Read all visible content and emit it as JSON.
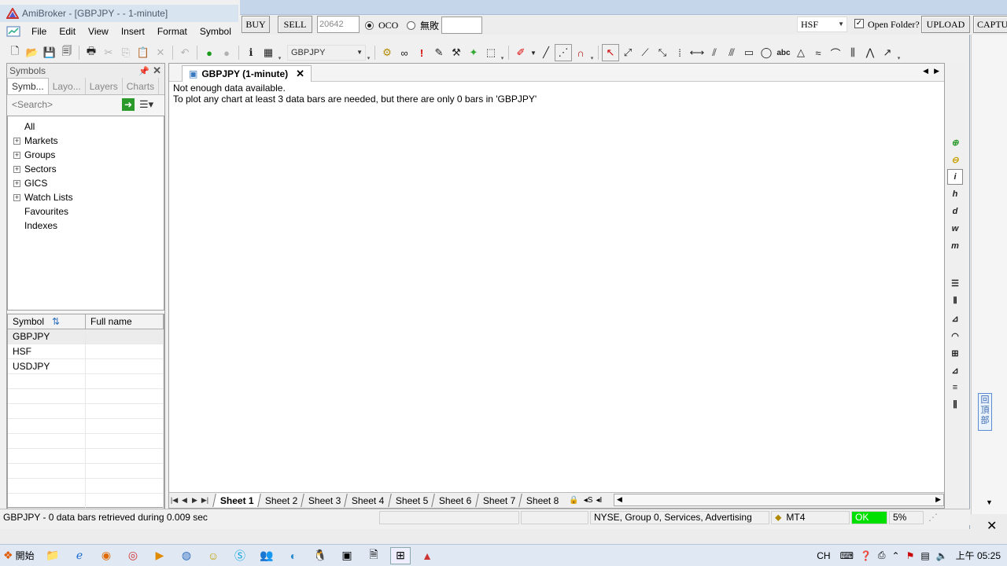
{
  "window": {
    "title": "AmiBroker - [GBPJPY -  - 1-minute]",
    "menu": [
      "File",
      "Edit",
      "View",
      "Insert",
      "Format",
      "Symbol"
    ]
  },
  "trade_bar": {
    "buy_label": "BUY",
    "sell_label": "SELL",
    "qty_value": "20642",
    "oco_label": "OCO",
    "oco_selected": true,
    "other_radio_label": "無敗",
    "symbol_value": "HSF",
    "open_folder_label": "Open Folder?",
    "open_folder_checked": true,
    "upload_label": "UPLOAD",
    "capture_label": "CAPTU"
  },
  "toolbar": {
    "symbol_combo": "GBPJPY"
  },
  "symbols_panel": {
    "title": "Symbols",
    "tabs": [
      "Symb...",
      "Layo...",
      "Layers",
      "Charts"
    ],
    "search_placeholder": "<Search>",
    "tree": [
      {
        "label": "All",
        "expandable": false
      },
      {
        "label": "Markets",
        "expandable": true
      },
      {
        "label": "Groups",
        "expandable": true
      },
      {
        "label": "Sectors",
        "expandable": true
      },
      {
        "label": "GICS",
        "expandable": true
      },
      {
        "label": "Watch Lists",
        "expandable": true
      },
      {
        "label": "Favourites",
        "expandable": false
      },
      {
        "label": "Indexes",
        "expandable": false
      }
    ],
    "columns": [
      "Symbol",
      "Full name"
    ],
    "rows": [
      {
        "symbol": "GBPJPY",
        "full_name": ""
      },
      {
        "symbol": "HSF",
        "full_name": ""
      },
      {
        "symbol": "USDJPY",
        "full_name": ""
      }
    ]
  },
  "chart": {
    "tab_label": "GBPJPY (1-minute)",
    "message_line1": "Not enough data available.",
    "message_line2": "To plot any chart at least 3 data bars are needed, but there are only 0 bars in 'GBPJPY'",
    "sheets": [
      "Sheet 1",
      "Sheet 2",
      "Sheet 3",
      "Sheet 4",
      "Sheet 5",
      "Sheet 6",
      "Sheet 7",
      "Sheet 8"
    ],
    "active_sheet": "Sheet 1",
    "sheet_extra": [
      "S",
      "I"
    ]
  },
  "right_toolbar": {
    "interval_buttons": [
      "i",
      "h",
      "d",
      "w",
      "m"
    ]
  },
  "scroll_badge": "回頂部",
  "status_bar": {
    "message": "GBPJPY - 0 data bars retrieved during 0.009 sec",
    "info": "NYSE, Group 0, Services, Advertising",
    "database": "MT4",
    "state": "OK",
    "percent": "5%"
  },
  "taskbar": {
    "start_label": "開始",
    "language": "CH",
    "clock": "上午 05:25"
  },
  "colors": {
    "ok_green": "#00e000",
    "title_bg": "#d9e4f1",
    "trade_bar_bg": "#c5d6ea"
  }
}
